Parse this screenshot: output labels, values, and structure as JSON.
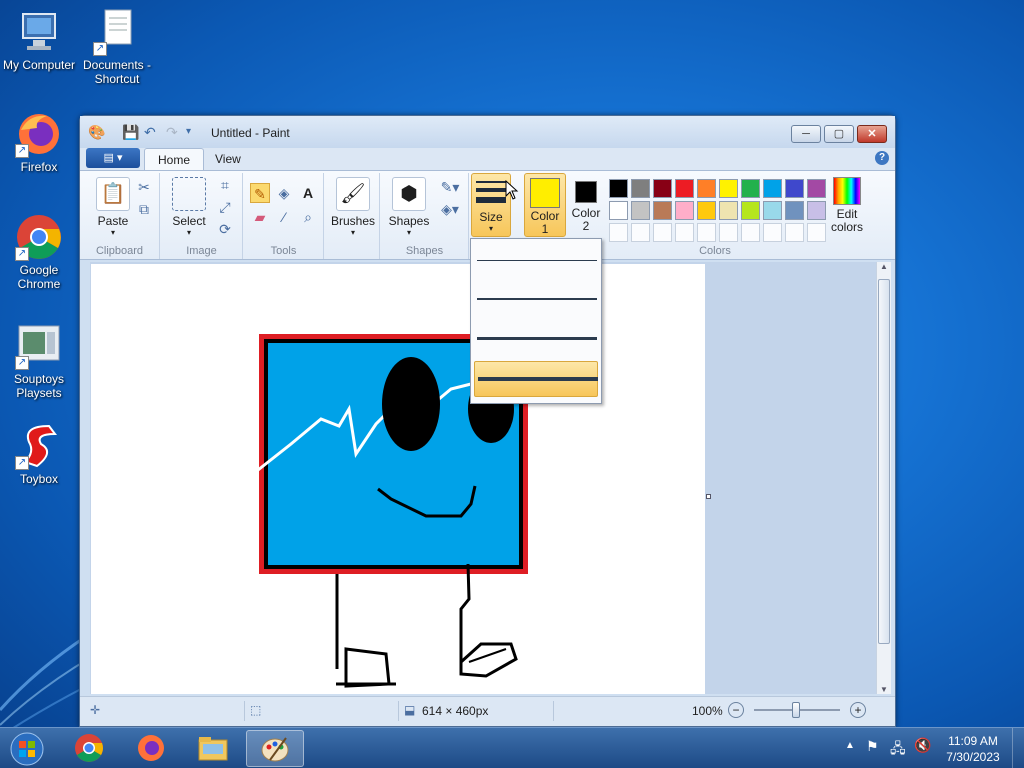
{
  "desktop": {
    "icons": [
      {
        "label": "My Computer",
        "icon": "computer-icon"
      },
      {
        "label": "Documents - Shortcut",
        "icon": "documents-icon"
      },
      {
        "label": "Firefox",
        "icon": "firefox-icon"
      },
      {
        "label": "Google Chrome",
        "icon": "chrome-icon"
      },
      {
        "label": "Souptoys Playsets",
        "icon": "souptoys-icon"
      },
      {
        "label": "Toybox",
        "icon": "toybox-icon"
      }
    ]
  },
  "window": {
    "title": "Untitled - Paint",
    "tabs": {
      "home": "Home",
      "view": "View"
    },
    "controls": {
      "minimize": "─",
      "maximize": "▢",
      "close": "✕"
    }
  },
  "ribbon": {
    "clipboard": {
      "group": "Clipboard",
      "paste": "Paste"
    },
    "image": {
      "group": "Image",
      "select": "Select"
    },
    "tools": {
      "group": "Tools"
    },
    "shapes_group": {
      "group": "Shapes",
      "brushes": "Brushes",
      "shapes": "Shapes"
    },
    "size": {
      "label": "Size"
    },
    "color1": {
      "label": "Color 1",
      "value": "#ffee00"
    },
    "color2": {
      "label": "Color 2",
      "value": "#000000"
    },
    "colors": {
      "group": "Colors",
      "row1": [
        "#000000",
        "#7f7f7f",
        "#880015",
        "#ed1c24",
        "#ff7f27",
        "#fff200",
        "#22b14c",
        "#00a2e8",
        "#3f48cc",
        "#a349a4"
      ],
      "row2": [
        "#ffffff",
        "#c3c3c3",
        "#b97a57",
        "#ffaec9",
        "#ffc90e",
        "#efe4b0",
        "#b5e61d",
        "#99d9ea",
        "#7092be",
        "#c8bfe7"
      ],
      "edit": "Edit colors"
    }
  },
  "size_dropdown": {
    "options": [
      "1px",
      "3px",
      "5px",
      "8px"
    ],
    "selected": "8px"
  },
  "status": {
    "dimensions": "614 × 460px",
    "zoom": "100%"
  },
  "taskbar": {
    "items": [
      "start",
      "chrome",
      "firefox",
      "explorer",
      "paint"
    ],
    "active": "paint",
    "time": "11:09 AM",
    "date": "7/30/2023"
  }
}
